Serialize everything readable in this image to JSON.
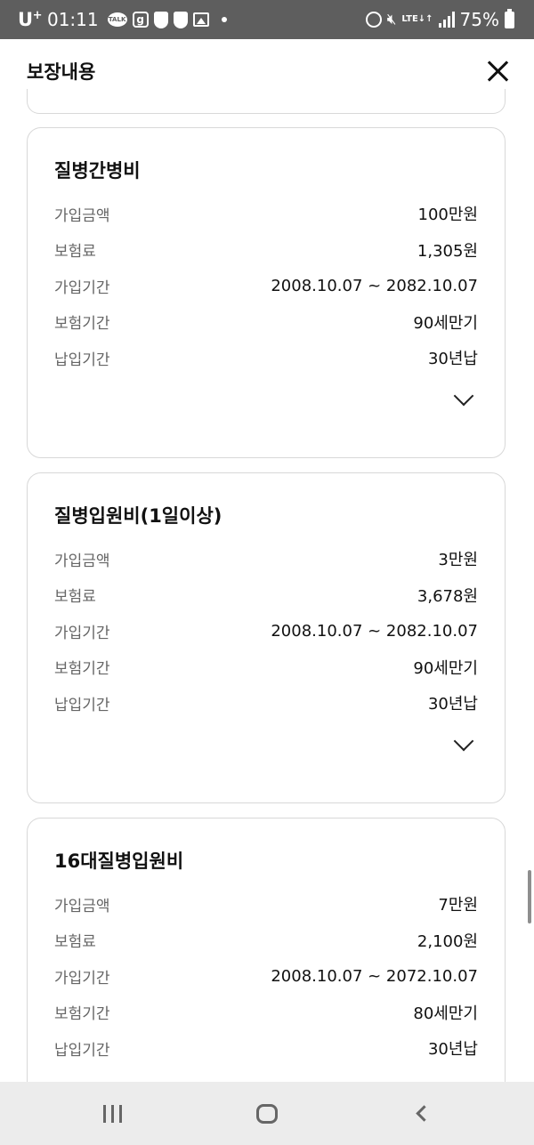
{
  "status_bar": {
    "carrier": "U",
    "carrier_sup": "+",
    "time": "01:11",
    "talk_label": "TALK",
    "g_label": "g",
    "lte_top": "LTE",
    "lte_bottom": "↓↑",
    "battery": "75%"
  },
  "header": {
    "title": "보장내용"
  },
  "cards": [
    {
      "title": "질병간병비",
      "rows": [
        {
          "label": "가입금액",
          "value": "100만원"
        },
        {
          "label": "보험료",
          "value": "1,305원"
        },
        {
          "label": "가입기간",
          "value": "2008.10.07 ~ 2082.10.07"
        },
        {
          "label": "보험기간",
          "value": "90세만기"
        },
        {
          "label": "납입기간",
          "value": "30년납"
        }
      ]
    },
    {
      "title": "질병입원비(1일이상)",
      "rows": [
        {
          "label": "가입금액",
          "value": "3만원"
        },
        {
          "label": "보험료",
          "value": "3,678원"
        },
        {
          "label": "가입기간",
          "value": "2008.10.07 ~ 2082.10.07"
        },
        {
          "label": "보험기간",
          "value": "90세만기"
        },
        {
          "label": "납입기간",
          "value": "30년납"
        }
      ]
    },
    {
      "title": "16대질병입원비",
      "rows": [
        {
          "label": "가입금액",
          "value": "7만원"
        },
        {
          "label": "보험료",
          "value": "2,100원"
        },
        {
          "label": "가입기간",
          "value": "2008.10.07 ~ 2072.10.07"
        },
        {
          "label": "보험기간",
          "value": "80세만기"
        },
        {
          "label": "납입기간",
          "value": "30년납"
        }
      ]
    }
  ],
  "icons": {
    "close": "close-icon",
    "expand": "chevron-down-icon",
    "nav_recents": "recents-icon",
    "nav_home": "home-icon",
    "nav_back": "back-icon"
  }
}
